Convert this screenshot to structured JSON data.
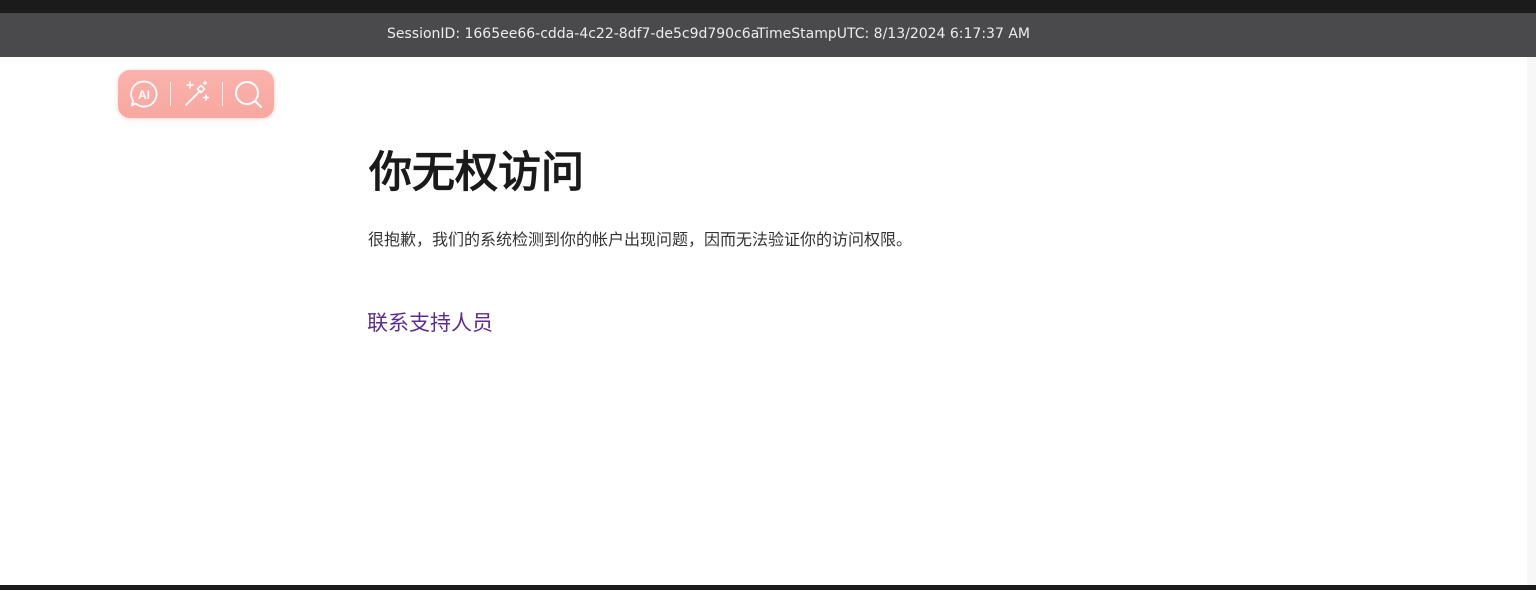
{
  "session_bar": {
    "session_id": "SessionID: 1665ee66-cdda-4c22-8df7-de5c9d790c6a",
    "timestamp": "TimeStampUTC: 8/13/2024 6:17:37 AM"
  },
  "toolbar": {
    "ai_icon_text": "AI",
    "tools": [
      "ai-chat-icon",
      "magic-wand-icon",
      "search-icon"
    ],
    "accent_color": "#f9aea7"
  },
  "main": {
    "title": "你无权访问",
    "message": "很抱歉，我们的系统检测到你的帐户出现问题，因而无法验证你的访问权限。",
    "support_link": "联系支持人员",
    "link_color": "#5c2d91"
  }
}
